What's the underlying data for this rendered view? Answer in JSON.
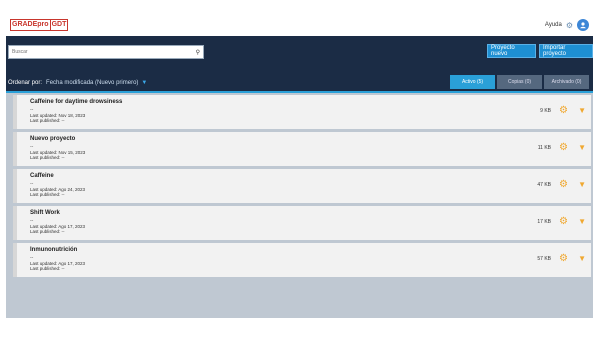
{
  "app": {
    "logo_left": "GRADEpro",
    "logo_right": "GDT"
  },
  "header": {
    "help": "Ayuda",
    "avatar_initial": "👤"
  },
  "search": {
    "placeholder": "Buscar"
  },
  "actions": {
    "new_project": "Proyecto nuevo",
    "import_project": "Importar proyecto"
  },
  "sort": {
    "label": "Ordenar por:",
    "value": "Fecha modificada (Nuevo primero)"
  },
  "tabs": [
    {
      "label": "Activo (5)",
      "active": true
    },
    {
      "label": "Copias (0)",
      "active": false
    },
    {
      "label": "Archivado (0)",
      "active": false
    }
  ],
  "projects": [
    {
      "title": "Caffeine for daytime drowsiness",
      "dash": "--",
      "updated": "Last updated: Nov 18, 2023",
      "published": "Last published: --",
      "size": "9 KB"
    },
    {
      "title": "Nuevo proyecto",
      "dash": "--",
      "updated": "Last updated: Nov 15, 2023",
      "published": "Last published: --",
      "size": "11 KB"
    },
    {
      "title": "Caffeine",
      "dash": "--",
      "updated": "Last updated: Ago 24, 2023",
      "published": "Last published: --",
      "size": "47 KB"
    },
    {
      "title": "Shift Work",
      "dash": "--",
      "updated": "Last updated: Ago 17, 2023",
      "published": "Last published: --",
      "size": "17 KB"
    },
    {
      "title": "Inmunonutrición",
      "dash": "--",
      "updated": "Last updated: Ago 17, 2023",
      "published": "Last published: --",
      "size": "57 KB"
    }
  ]
}
